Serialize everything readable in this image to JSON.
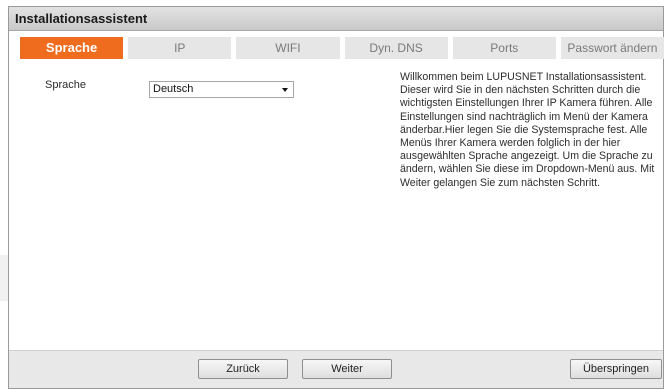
{
  "window": {
    "title": "Installationsassistent"
  },
  "tabs": [
    {
      "label": "Sprache",
      "active": true
    },
    {
      "label": "IP",
      "active": false
    },
    {
      "label": "WIFI",
      "active": false
    },
    {
      "label": "Dyn. DNS",
      "active": false
    },
    {
      "label": "Ports",
      "active": false
    },
    {
      "label": "Passwort ändern",
      "active": false
    }
  ],
  "form": {
    "language_label": "Sprache",
    "language_value": "Deutsch"
  },
  "info_text": "Willkommen beim LUPUSNET Installationsassistent. Dieser wird Sie in den nächsten Schritten durch die wichtigsten Einstellungen Ihrer IP Kamera führen. Alle Einstellungen sind nachträglich im Menü der Kamera änderbar.Hier legen Sie die Systemsprache fest. Alle Menüs Ihrer Kamera werden folglich in der hier ausgewählten Sprache angezeigt. Um die Sprache zu ändern, wählen Sie diese im Dropdown-Menü aus. Mit Weiter gelangen Sie zum nächsten Schritt.",
  "buttons": {
    "back": "Zurück",
    "next": "Weiter",
    "skip": "Überspringen"
  },
  "colors": {
    "accent": "#ef6c1e",
    "tab_inactive": "#e6e6e6"
  }
}
